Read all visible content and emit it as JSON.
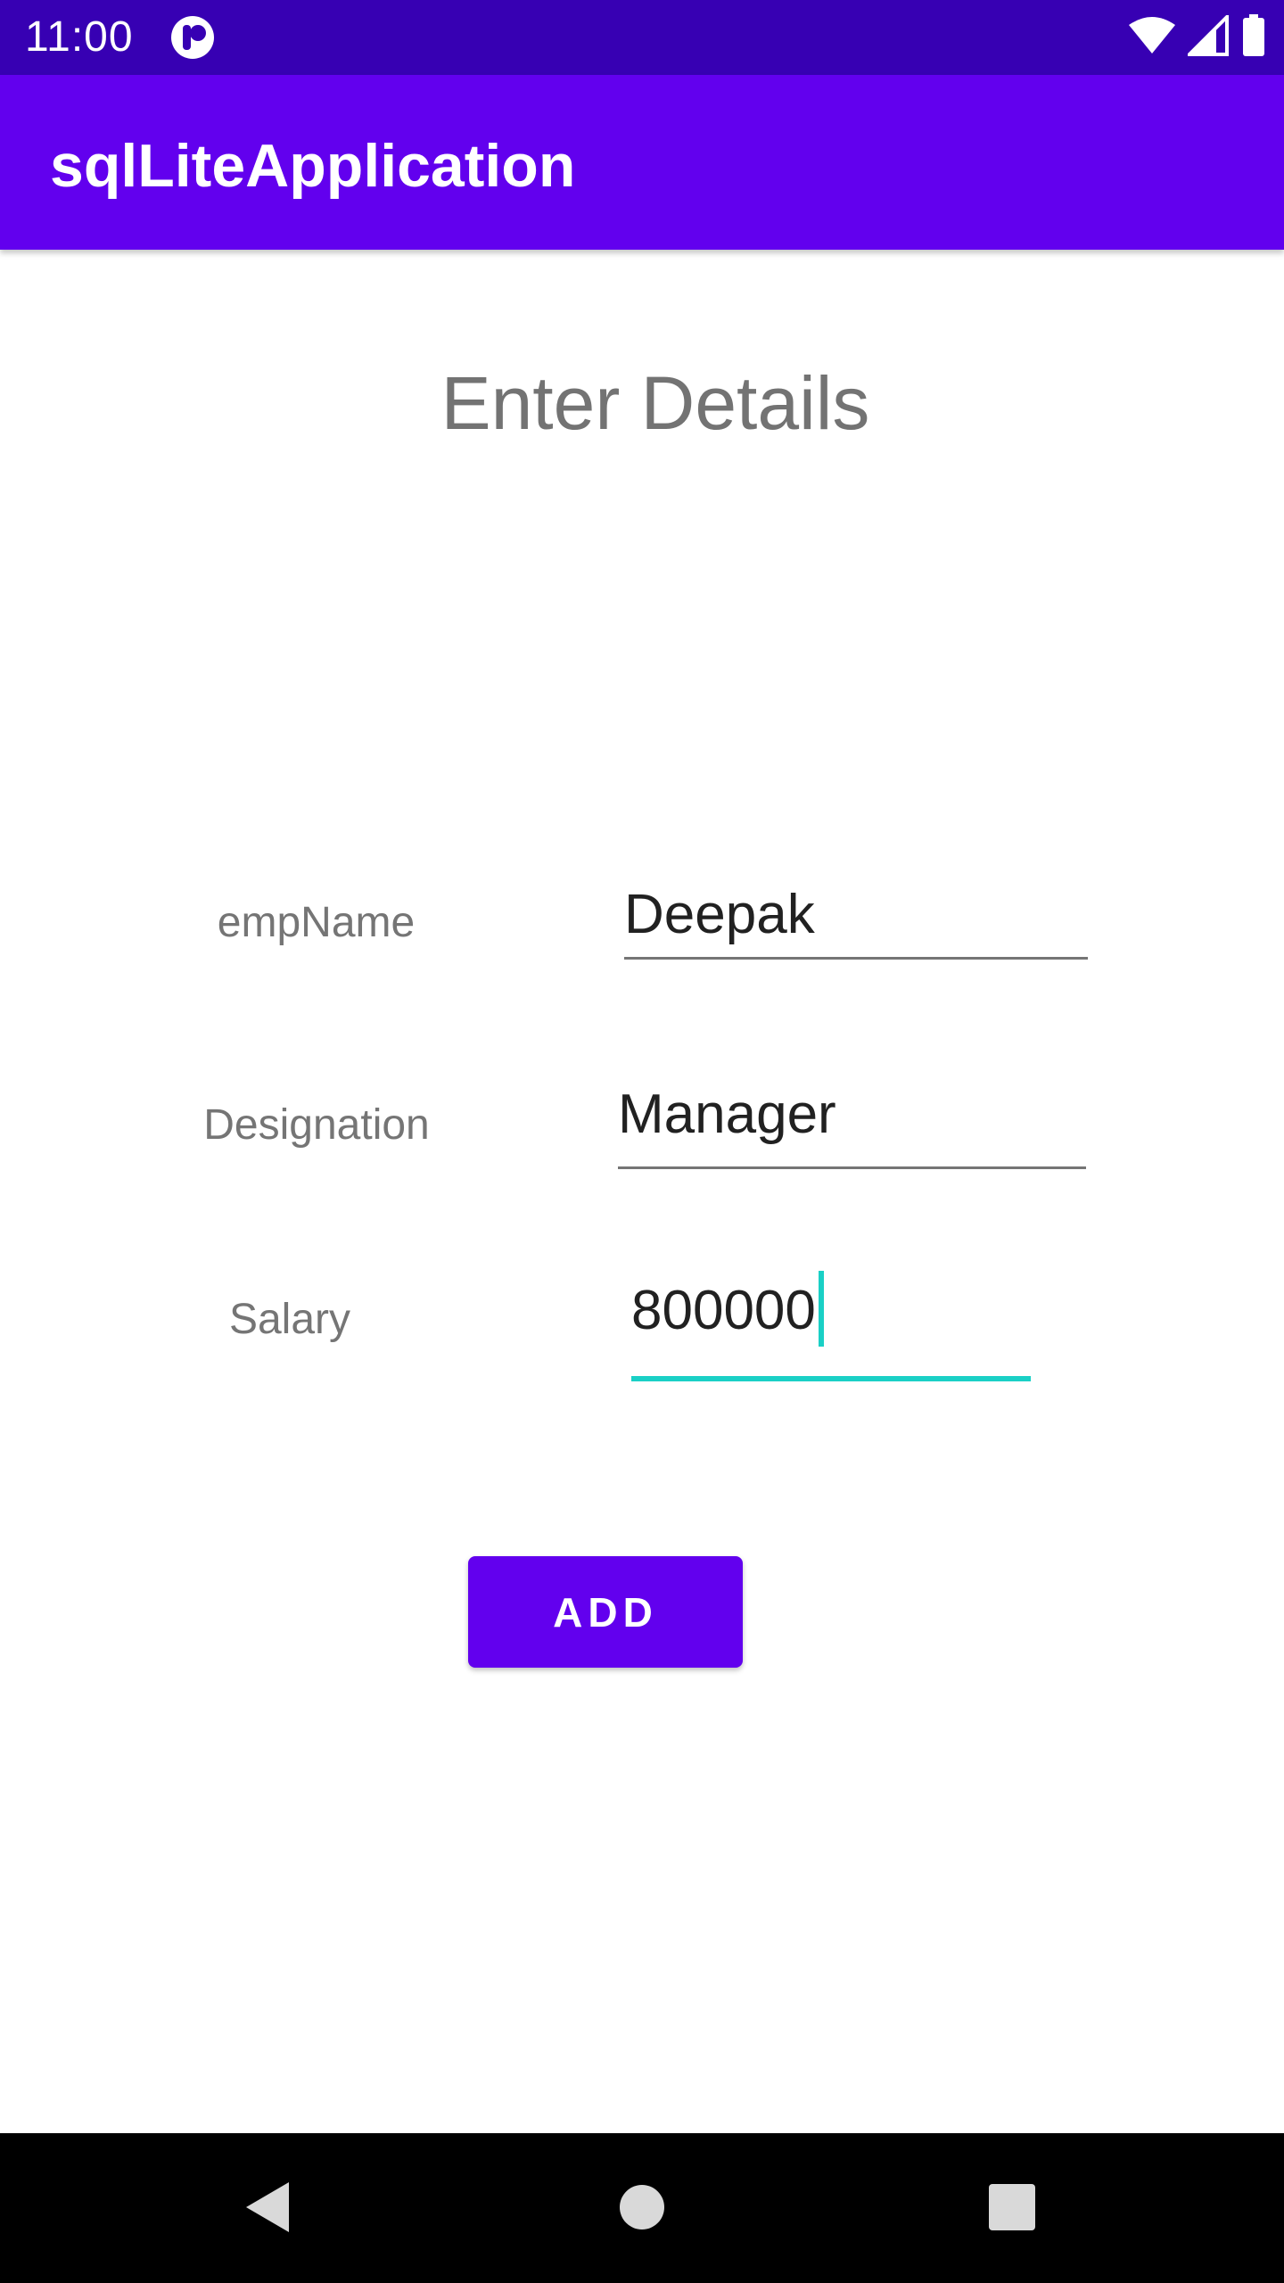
{
  "status_bar": {
    "time": "11:00",
    "icons": [
      "app-notification-icon",
      "wifi-icon",
      "cellular-signal-icon",
      "battery-icon"
    ]
  },
  "app_bar": {
    "title": "sqlLiteApplication"
  },
  "form": {
    "heading": "Enter Details",
    "fields": [
      {
        "label": "empName",
        "value": "Deepak"
      },
      {
        "label": "Designation",
        "value": "Manager"
      },
      {
        "label": "Salary",
        "value": "800000"
      }
    ],
    "add_button_label": "ADD"
  },
  "nav_bar": {
    "icons": [
      "back-icon",
      "home-icon",
      "recents-icon"
    ]
  },
  "colors": {
    "status_bar": "#3700b3",
    "primary": "#6200ee",
    "accent": "#1ad0c6",
    "heading_text": "#737373",
    "label_text": "#757575"
  }
}
